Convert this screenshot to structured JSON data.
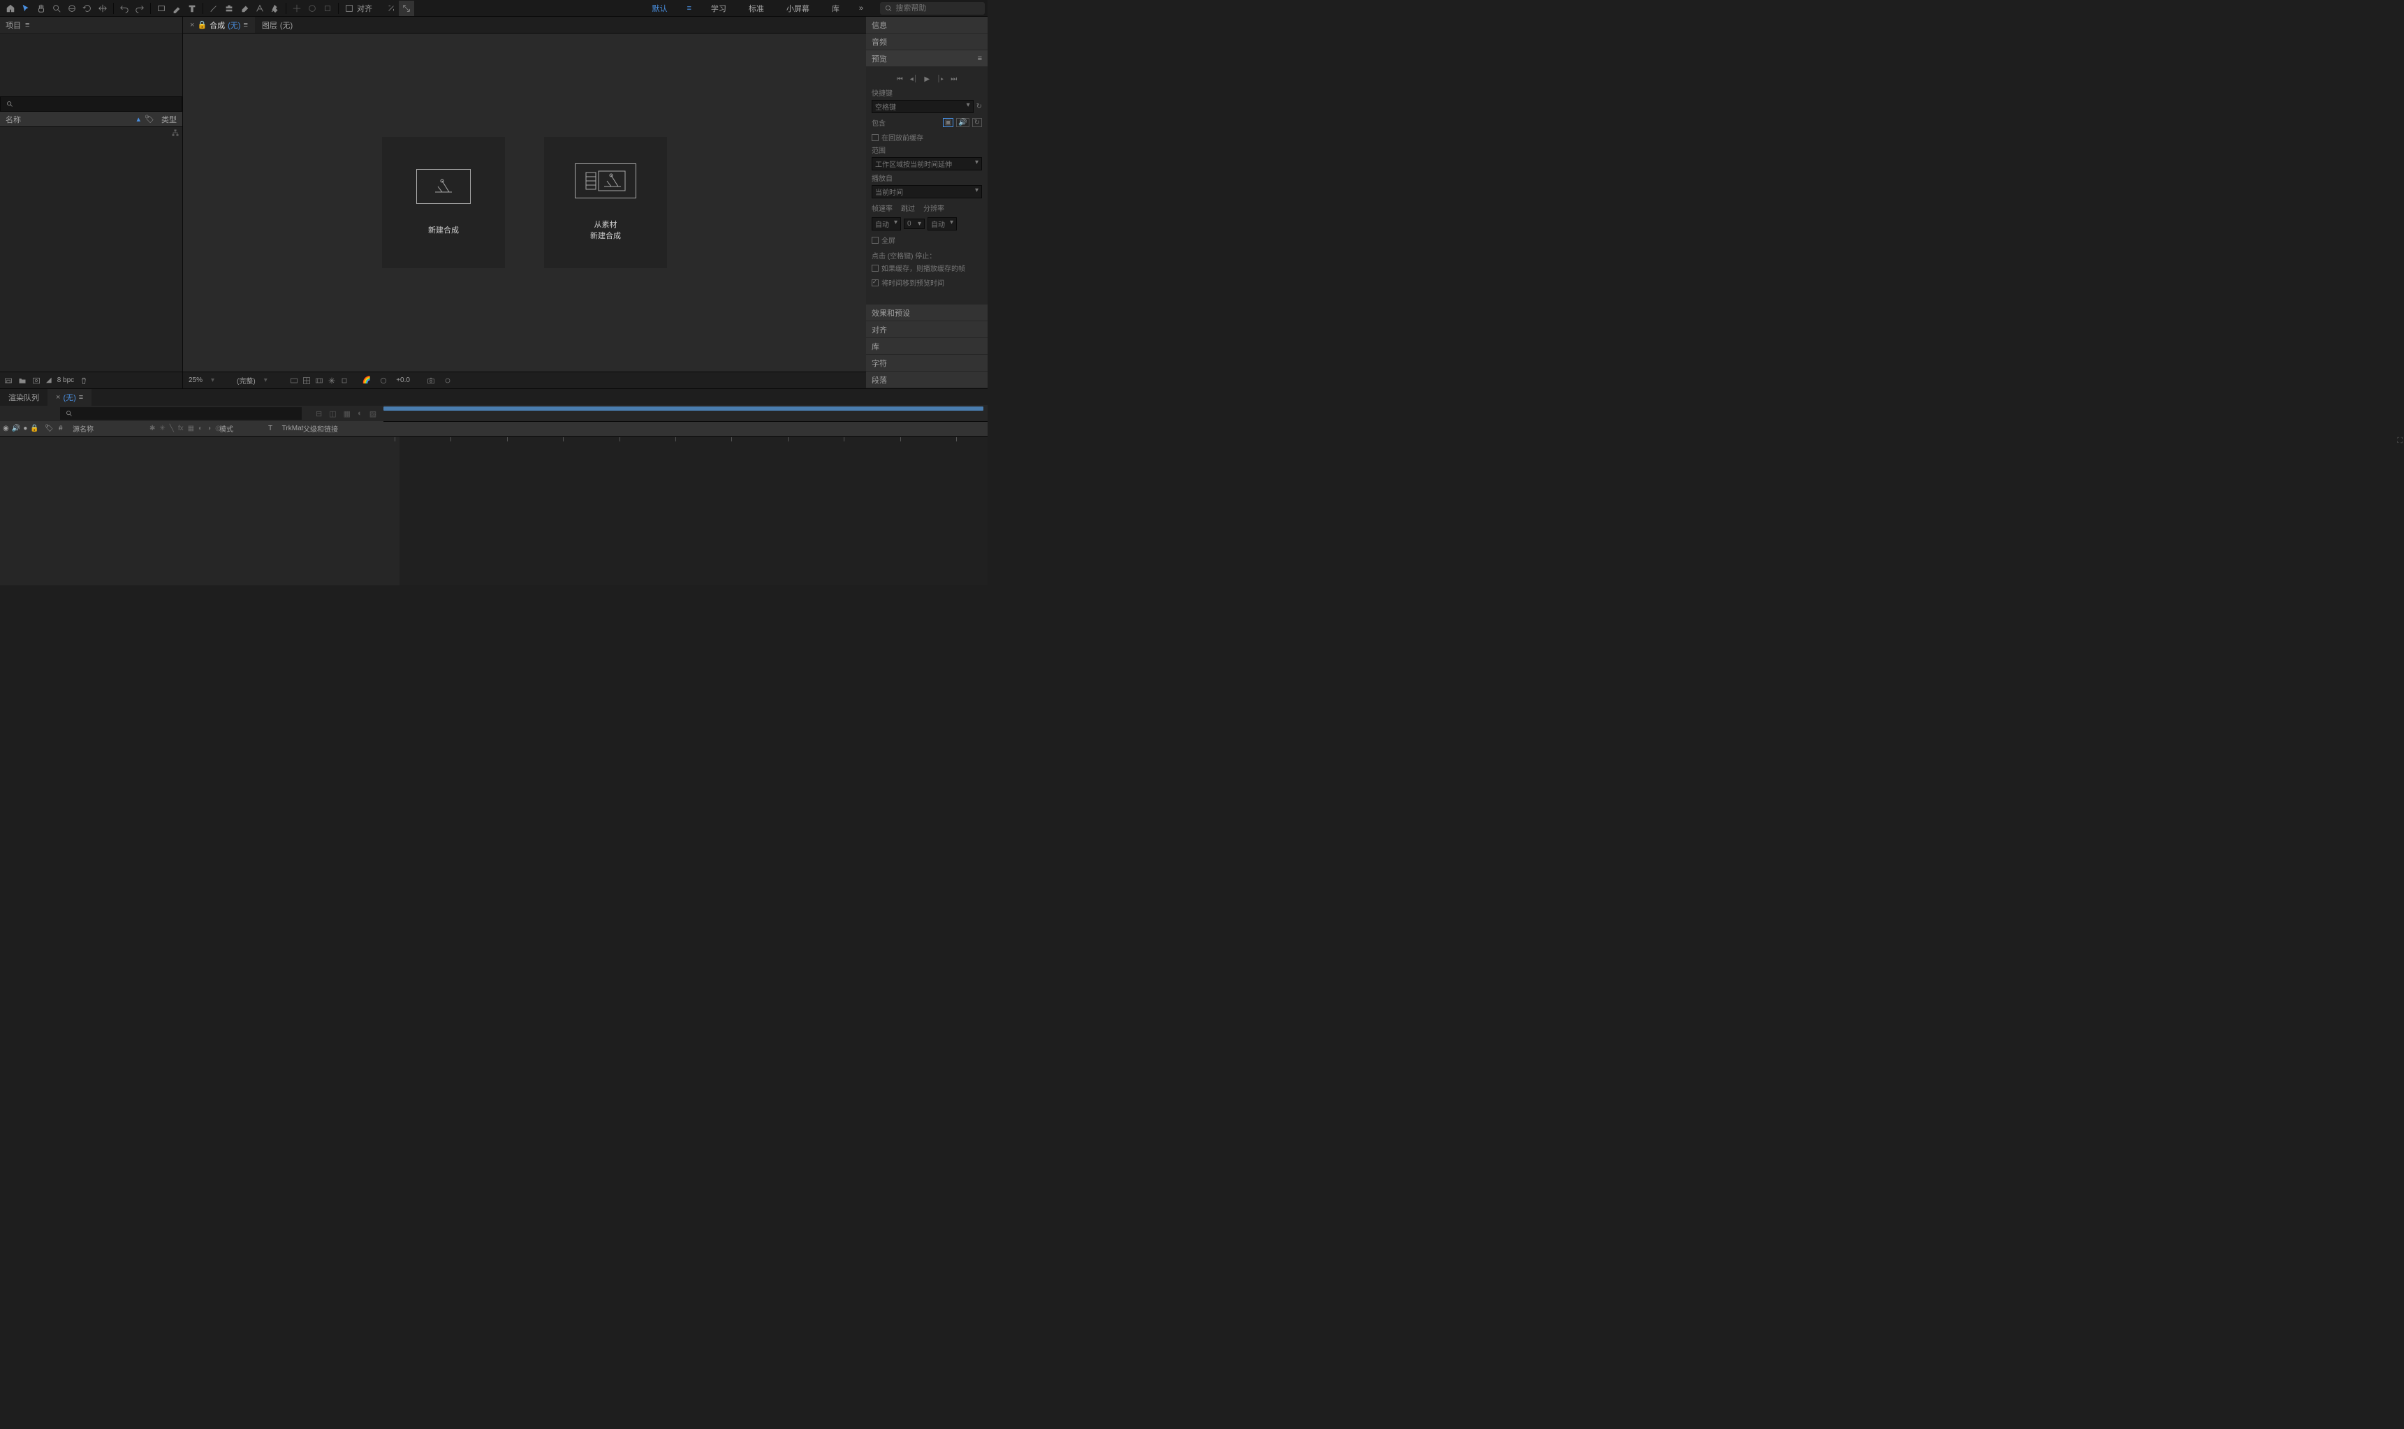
{
  "toolbar": {
    "snap_label": "对齐",
    "workspaces": [
      "默认",
      "学习",
      "标准",
      "小屏幕",
      "库"
    ],
    "active_ws": 0,
    "search_placeholder": "搜索帮助"
  },
  "project": {
    "title": "项目",
    "col_name": "名称",
    "col_type": "类型",
    "bpc": "8 bpc"
  },
  "viewer": {
    "comp_tab": "合成",
    "comp_none": "(无)",
    "layer_tab": "图层",
    "layer_none": "(无)",
    "card1": "新建合成",
    "card2_l1": "从素材",
    "card2_l2": "新建合成",
    "zoom": "25%",
    "res": "(完整)",
    "exposure": "+0.0"
  },
  "panels": {
    "info": "信息",
    "audio": "音频",
    "preview": "预览",
    "effects": "效果和预设",
    "align": "对齐",
    "library": "库",
    "character": "字符",
    "paragraph": "段落"
  },
  "preview": {
    "shortcut_label": "快捷键",
    "shortcut_val": "空格键",
    "include": "包含",
    "cache_before": "在回放前缓存",
    "range": "范围",
    "range_val": "工作区域按当前时间延伸",
    "play_from": "播放自",
    "play_from_val": "当前时间",
    "fps": "帧速率",
    "skip": "跳过",
    "res": "分辨率",
    "fps_val": "自动",
    "skip_val": "0",
    "res_val": "自动",
    "fullscreen": "全屏",
    "stop_hint": "点击 (空格键) 停止：",
    "if_cached": "如果缓存，则播放缓存的帧",
    "move_time": "将时间移到预览时间"
  },
  "timeline": {
    "render_queue": "渲染队列",
    "none": "(无)",
    "col_src": "源名称",
    "col_mode": "模式",
    "col_trkmat": "TrkMat",
    "col_parent": "父级和链接",
    "t_label": "T"
  }
}
